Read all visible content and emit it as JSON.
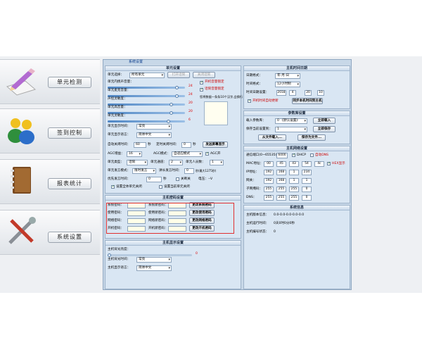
{
  "nav": {
    "unit_check": "单元检测",
    "sign_control": "签到控制",
    "report_stats": "报表统计",
    "system_settings": "系统设置"
  },
  "window": {
    "title": "系统设置"
  },
  "unit_settings": {
    "header": "单元设置",
    "unit_select_label": "单元选择：",
    "unit_select_value": "所有单元",
    "btn_open_clock": "打开话筒",
    "btn_close_clock": "关闭话筒",
    "volume_label": "单元内扬声音量：",
    "volume_value": "24",
    "mic_gain_label": "单元麦克音量：",
    "mic_gain_value": "24",
    "bass_label": "声控灵敏度：",
    "bass_value": "20",
    "treble_label": "单元高音量：",
    "treble_value": "20",
    "sensitivity_label": "单元灵敏度：",
    "sensitivity_value": "6",
    "chk_vol_lock": "开机音量锁定",
    "chk_mic_lock": "话筒音量锁定",
    "hint": "您将数据一条条10个汉字,会换行",
    "display_mode_label": "单元显示时间：",
    "display_mode_value": "常亮",
    "language_label": "单元显示语言：",
    "language_value": "简体中文",
    "auto_off_label": "自动关闭时间：",
    "auto_off_value": "60",
    "auto_off_unit": "秒",
    "timer_label": "定时关闭时间：",
    "timer_value": "0",
    "timer_unit": "秒",
    "btn_send_text": "发送屏幕显示",
    "agc_gain_label": "AGC增益：",
    "agc_gain_value": "16",
    "agc_mode_label": "AGC模式：",
    "agc_mode_value": "自适应模式",
    "chk_agc": "AGC开",
    "unit_type_label": "单元类型：",
    "unit_type_value": "话筒",
    "unit_channel_label": "单元通道：",
    "unit_channel_value": "2",
    "unit_people_label": "单元人员数：",
    "unit_people_value": "1",
    "speak_mode_label": "单元发言模式：",
    "speak_mode_value": "限时发言",
    "speak_time_label": "讲长发言时间：",
    "speak_time_value": "0",
    "speak_time_unit": "秒(最大1275秒)",
    "priority_label": "优先发言时间：",
    "priority_value": "0",
    "priority_unit": "秒",
    "chk_shutdown": "关断关",
    "power_label": "电压：",
    "power_value": "--V",
    "chk_reset_all": "设置全体单元关闭",
    "chk_reset_one": "设置当前单元关闭"
  },
  "password": {
    "header": "主机密码设置",
    "sys_label": "系统密码：",
    "sys_label2": "系统新密码：",
    "sys_btn": "更改系统密码",
    "use_label": "使用密码：",
    "use_label2": "使用新密码：",
    "use_btn": "更改使用密码",
    "net_label": "网络密码：",
    "net_label2": "网络新密码：",
    "net_btn": "更改网络密码",
    "boot_label": "开机密码：",
    "boot_label2": "开机新密码：",
    "boot_btn": "更改开机密码"
  },
  "host_display": {
    "header": "主机显示设置",
    "bright_label": "主机背光亮度：",
    "bright_value": "0",
    "mode_label": "主机背光时间：",
    "mode_value": "常亮",
    "lang_label": "主机显示语言：",
    "lang_value": "简体中文"
  },
  "host_time": {
    "header": "主机时间日期",
    "date_fmt_label": "日期格式：",
    "date_fmt_value": "年-月-日",
    "time_fmt_label": "时间格式：",
    "time_fmt_value": "12小时制",
    "time_set_label": "时间日期设置：",
    "year": "2018",
    "month": "4",
    "day": "20",
    "hour": "10",
    "chk_sync": "开机时间自动更新",
    "btn_sync": "同步本机时间到主机"
  },
  "params": {
    "header": "参数库设置",
    "load_label": "载入参数库：",
    "load_value": "0 《默认设置》",
    "load_btn": "立即载入",
    "save_label": "保存当前设置到：",
    "save_value": "1",
    "save_btn": "立即保存",
    "file_load_btn": "从文件载入...",
    "file_save_btn": "保存为文件..."
  },
  "network": {
    "header": "主机网络设置",
    "port_label": "通信端口(0~65535)：",
    "port_value": "6000",
    "chk_dhcp": "DHCP",
    "chk_dns": "自动DNS",
    "mac_label": "MAC地址：",
    "mac": [
      "00",
      "45",
      "43",
      "54",
      "4c"
    ],
    "chk_hex": "HEX显示",
    "ip_label": "IP地址：",
    "ip": [
      "192",
      "168",
      "1",
      "234"
    ],
    "gw_label": "网关：",
    "gw": [
      "192",
      "168",
      "1",
      "1"
    ],
    "mask_label": "子网掩码：",
    "mask": [
      "255",
      "255",
      "255",
      "0"
    ],
    "dns_label": "DNS：",
    "dns": [
      "255",
      "255",
      "255",
      "0"
    ]
  },
  "sysinfo": {
    "header": "系统信息",
    "ver_label": "主机版本信息：",
    "ver_value": "0.0-0.0-0.0-0.0-0.0",
    "run_label": "主机运行时间：",
    "run_value": "0天0时0分0秒",
    "units_label": "主机编号状态：",
    "units_value": "0"
  },
  "colors": {
    "accent": "#3a78c2",
    "panel": "#d9e6f3",
    "highlight": "#e03030"
  }
}
